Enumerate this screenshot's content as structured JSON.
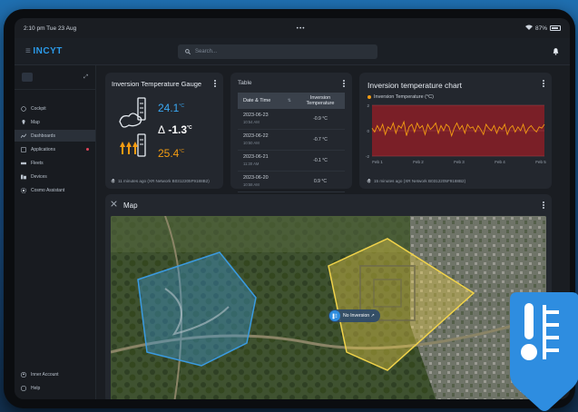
{
  "status_bar": {
    "time": "2:10 pm  Tue 23 Aug",
    "dots": "•••",
    "battery": "87%"
  },
  "app": {
    "logo": "INCYT",
    "search_placeholder": "Search..."
  },
  "sidebar": {
    "items": [
      {
        "label": "Cockpit",
        "icon": "compass-icon"
      },
      {
        "label": "Map",
        "icon": "map-pin-icon"
      },
      {
        "label": "Dashboards",
        "icon": "chart-line-icon",
        "active": true
      },
      {
        "label": "Applications",
        "icon": "apps-icon",
        "alert": true
      },
      {
        "label": "Fleets",
        "icon": "fleet-icon"
      },
      {
        "label": "Devices",
        "icon": "devices-icon"
      },
      {
        "label": "Cosmo Assistant",
        "icon": "assistant-icon"
      }
    ],
    "bottom": [
      {
        "label": "Inner Account",
        "icon": "account-icon"
      },
      {
        "label": "Help",
        "icon": "help-icon"
      }
    ]
  },
  "gauge": {
    "title": "Inversion Temperature Gauge",
    "top_value": "24.1",
    "top_unit": "°C",
    "delta_symbol": "Δ",
    "delta_value": "-1.3",
    "delta_unit": "°C",
    "bottom_value": "25.4",
    "bottom_unit": "°C",
    "footer": "11 minutes ago (XR Network B0312205F9188B2)",
    "colors": {
      "top": "#3aa8f2",
      "bottom": "#f39c12"
    }
  },
  "table": {
    "title": "Table",
    "headers": [
      "Date & Time",
      "Inversion Temperature"
    ],
    "sort_glyph": "⇅",
    "rows": [
      {
        "date": "2023-06-23",
        "time": "10:54 AM",
        "value": "-0.9 °C"
      },
      {
        "date": "2023-06-22",
        "time": "10:50 AM",
        "value": "-0.7 °C"
      },
      {
        "date": "2023-06-21",
        "time": "11:30 AM",
        "value": "-0.1 °C"
      },
      {
        "date": "2023-06-20",
        "time": "10:58 AM",
        "value": "0.9 °C"
      }
    ]
  },
  "chart": {
    "title": "Inversion temperature chart",
    "footer": "15 minutes ago (XR Network B0312205F9188B2)"
  },
  "chart_data": {
    "type": "line",
    "series": [
      {
        "name": "Inversion Temperature (°C)",
        "color": "#f39c12"
      }
    ],
    "y_ticks": [
      "2",
      "0",
      "-2"
    ],
    "ylim": [
      -2,
      2
    ],
    "x_ticks": [
      "Feb 1",
      "Feb 2",
      "Feb 3",
      "Feb 4",
      "Feb 5"
    ],
    "values": [
      0.2,
      -0.1,
      0.4,
      0.0,
      0.5,
      -0.3,
      0.3,
      0.1,
      0.6,
      -0.2,
      0.4,
      0.2,
      0.7,
      -0.4,
      0.3,
      0.5,
      -0.1,
      0.6,
      0.2,
      0.4,
      -0.3,
      0.5,
      0.1,
      0.3,
      0.6,
      -0.2,
      0.4,
      0.0,
      0.5,
      0.3,
      -0.4,
      0.2,
      0.6,
      0.1,
      0.4,
      -0.2,
      0.5,
      0.2,
      0.3,
      -0.1,
      0.4,
      0.1,
      -0.3,
      0.5,
      0.2,
      0.0,
      0.4,
      -0.2,
      0.3,
      0.1,
      0.5,
      -0.3,
      0.2,
      0.4,
      -0.1,
      0.3,
      0.0,
      0.5,
      -0.2,
      0.2,
      0.4,
      0.1,
      -0.1,
      0.3,
      0.2,
      0.5
    ],
    "plot_background": "#7a1f27",
    "grid": true
  },
  "map": {
    "title": "Map",
    "pin_label": "No Inversion ↗",
    "area_colors": {
      "blue": "#3a9ae0",
      "yellow": "#f1d34a"
    }
  }
}
